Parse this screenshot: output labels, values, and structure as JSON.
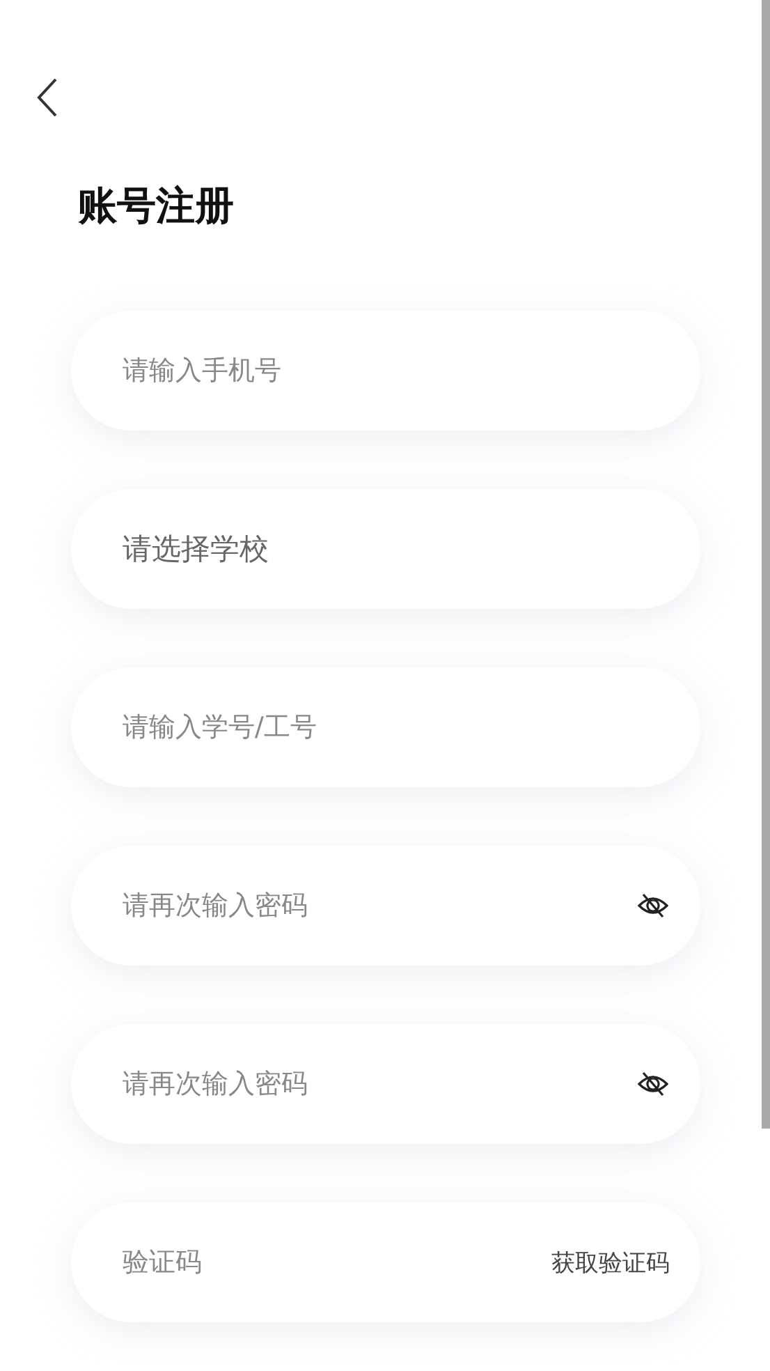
{
  "title": "账号注册",
  "fields": [
    {
      "kind": "text",
      "placeholder": "请输入手机号"
    },
    {
      "kind": "select",
      "placeholder": "请选择学校"
    },
    {
      "kind": "text",
      "placeholder": "请输入学号/工号"
    },
    {
      "kind": "password",
      "placeholder": "请再次输入密码"
    },
    {
      "kind": "password",
      "placeholder": "请再次输入密码"
    },
    {
      "kind": "code",
      "placeholder": "验证码",
      "action": "获取验证码"
    }
  ]
}
